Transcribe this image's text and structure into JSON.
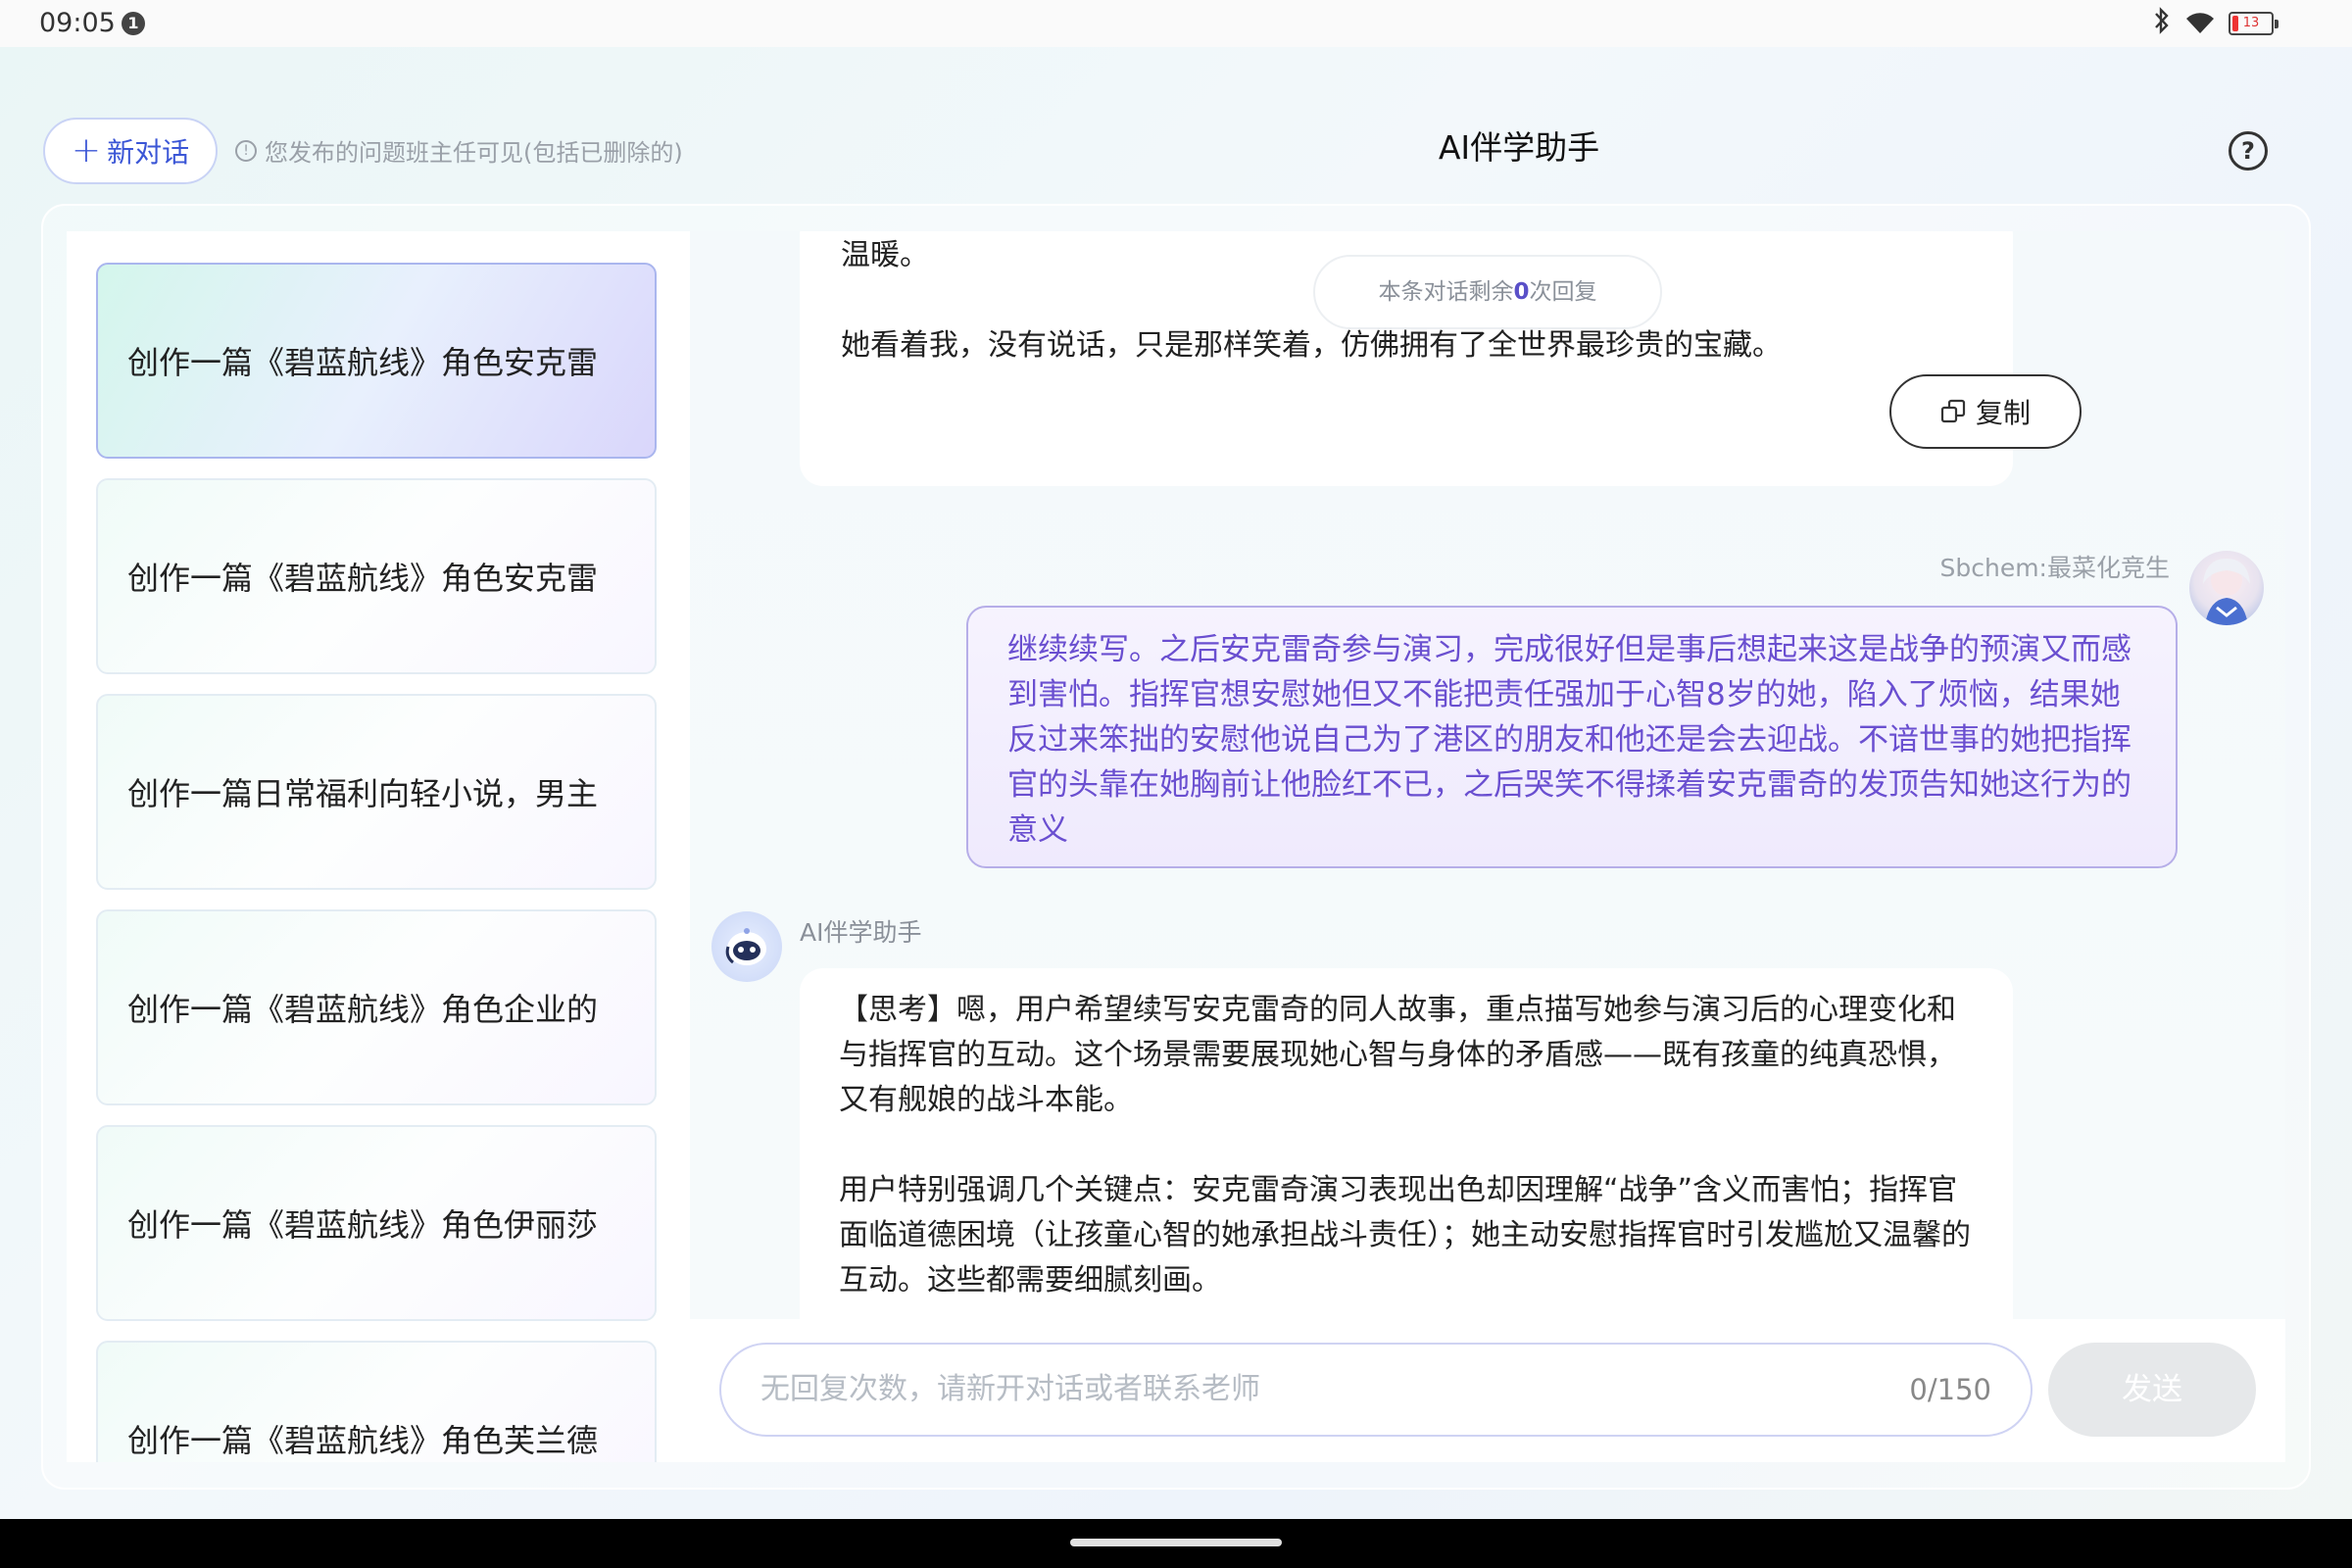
{
  "status_bar": {
    "time": "09:05",
    "notification_count": "1",
    "battery": "13",
    "icons": [
      "bluetooth-icon",
      "wifi-icon",
      "battery-icon"
    ]
  },
  "header": {
    "new_chat_label": "新对话",
    "new_chat_icon": "plus-icon",
    "notice": "您发布的问题班主任可见(包括已删除的)",
    "title": "AI伴学助手",
    "help_icon": "?"
  },
  "sidebar": {
    "items": [
      {
        "label": "创作一篇《碧蓝航线》角色安克雷",
        "active": true
      },
      {
        "label": "创作一篇《碧蓝航线》角色安克雷",
        "active": false
      },
      {
        "label": "创作一篇日常福利向轻小说，男主",
        "active": false
      },
      {
        "label": "创作一篇《碧蓝航线》角色企业的",
        "active": false
      },
      {
        "label": "创作一篇《碧蓝航线》角色伊丽莎",
        "active": false
      },
      {
        "label": "创作一篇《碧蓝航线》角色芙兰德",
        "active": false
      }
    ]
  },
  "chat": {
    "prev_ai_message": {
      "line1": "温暖。",
      "line2": "她看着我，没有说话，只是那样笑着，仿佛拥有了全世界最珍贵的宝藏。",
      "copy_label": "复制"
    },
    "remaining": {
      "prefix": "本条对话剩余",
      "count": "0",
      "suffix": "次回复"
    },
    "user": {
      "name": "Sbchem:最菜化竞生",
      "message": "继续续写。之后安克雷奇参与演习，完成很好但是事后想起来这是战争的预演又而感到害怕。指挥官想安慰她但又不能把责任强加于心智8岁的她，陷入了烦恼，结果她反过来笨拙的安慰他说自己为了港区的朋友和他还是会去迎战。不谙世事的她把指挥官的头靠在她胸前让他脸红不已，之后哭笑不得揉着安克雷奇的发顶告知她这行为的意义"
    },
    "ai": {
      "name": "AI伴学助手",
      "paragraph1": "【思考】嗯，用户希望续写安克雷奇的同人故事，重点描写她参与演习后的心理变化和与指挥官的互动。这个场景需要展现她心智与身体的矛盾感——既有孩童的纯真恐惧，又有舰娘的战斗本能。",
      "paragraph2": "用户特别强调几个关键点：安克雷奇演习表现出色却因理解“战争”含义而害怕；指挥官面临道德困境（让孩童心智的她承担战斗责任）；她主动安慰指挥官时引发尴尬又温馨的互动。这些都需要细腻刻画。"
    }
  },
  "input": {
    "placeholder": "无回复次数，请新开对话或者联系老师",
    "char_count": "0/150",
    "send_label": "发送"
  },
  "colors": {
    "accent": "#3b56d6",
    "user_text": "#6a4fd0",
    "user_border": "#b6aee8"
  }
}
